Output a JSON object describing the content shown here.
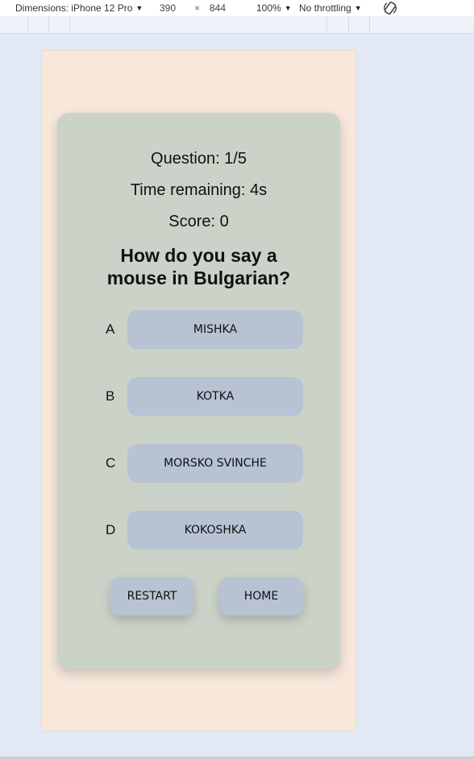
{
  "devtools": {
    "dimensions_label": "Dimensions: iPhone 12 Pro",
    "width": "390",
    "times": "×",
    "height": "844",
    "zoom": "100%",
    "throttling": "No throttling"
  },
  "quiz": {
    "question_counter": "Question:  1/5",
    "time_remaining": "Time remaining: 4s",
    "score": "Score:  0",
    "question_line1": "How do you say a",
    "question_line2": "mouse in Bulgarian?",
    "answers": [
      {
        "letter": "A",
        "text": "MISHKA"
      },
      {
        "letter": "B",
        "text": "KOTKA"
      },
      {
        "letter": "C",
        "text": "MORSKO SVINCHE"
      },
      {
        "letter": "D",
        "text": "KOKOSHKA"
      }
    ],
    "restart_label": "RESTART",
    "home_label": "HOME"
  },
  "colors": {
    "page_bg": "#e2e8f4",
    "viewport_bg": "#f7e8db",
    "card_bg": "#cbd3c9",
    "button_bg": "#b7c2d3"
  }
}
